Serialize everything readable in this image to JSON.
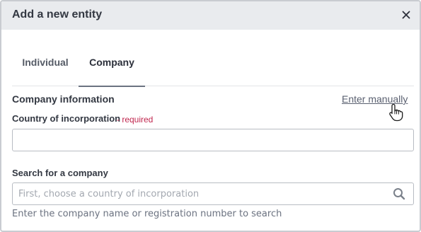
{
  "dialog": {
    "title": "Add a new entity",
    "close_icon": "close-icon"
  },
  "tabs": [
    {
      "label": "Individual",
      "active": false
    },
    {
      "label": "Company",
      "active": true
    }
  ],
  "company_section": {
    "title": "Company information",
    "enter_manually_link": "Enter manually"
  },
  "country_field": {
    "label": "Country of incorporation",
    "required_text": "- required",
    "value": ""
  },
  "search_field": {
    "label": "Search for a company",
    "placeholder": "First, choose a country of incorporation",
    "icon": "search-icon",
    "hint": "Enter the company name or registration number to search"
  },
  "colors": {
    "header_bg": "#e9ebee",
    "required": "#c0264e",
    "border": "#b8bcc3"
  }
}
